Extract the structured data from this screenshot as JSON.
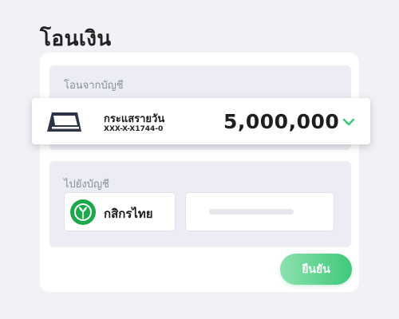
{
  "page": {
    "title": "โอนเงิน"
  },
  "from": {
    "label": "โอนจากบัญชี",
    "account_name": "กระแสรายวัน",
    "account_number": "XXX-X-X1744-0",
    "amount": "5,000,000",
    "icon": "wallet-icon",
    "expand_icon": "chevron-down-icon"
  },
  "to": {
    "label": "ไปยังบัญชี",
    "bank_name": "กสิกรไทย",
    "bank_icon": "kasikorn-logo-icon"
  },
  "actions": {
    "confirm_label": "ยืนยัน"
  },
  "colors": {
    "accent_green": "#3fc97c",
    "bank_green": "#1ba94c",
    "background": "#f1f1f6"
  }
}
